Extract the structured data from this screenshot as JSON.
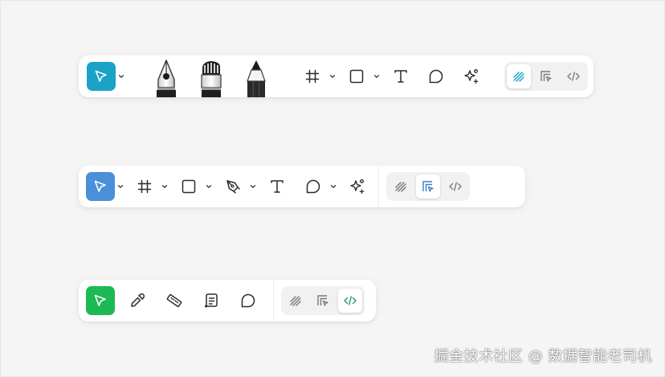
{
  "colors": {
    "toolbar1_accent": "#1aa3c7",
    "toolbar2_accent": "#4a90d9",
    "toolbar3_accent": "#1db954",
    "icon": "#2b2b2b",
    "mode_icon_muted": "#7a7a7a"
  },
  "toolbar1": {
    "selected_tool": "move-tool",
    "drawing_tools": [
      "fountain-pen",
      "marker",
      "pencil"
    ],
    "tools": [
      "frame",
      "rectangle",
      "text",
      "comment",
      "ai-actions"
    ],
    "active_mode": "draw"
  },
  "toolbar2": {
    "selected_tool": "move-tool",
    "tools": [
      "frame",
      "rectangle",
      "pen",
      "text",
      "comment",
      "ai-actions"
    ],
    "active_mode": "design"
  },
  "toolbar3": {
    "selected_tool": "move-tool",
    "tools": [
      "color-picker",
      "measure",
      "annotate",
      "comment"
    ],
    "active_mode": "dev"
  },
  "watermark": "掘金技术社区 @ 数据智能老司机"
}
